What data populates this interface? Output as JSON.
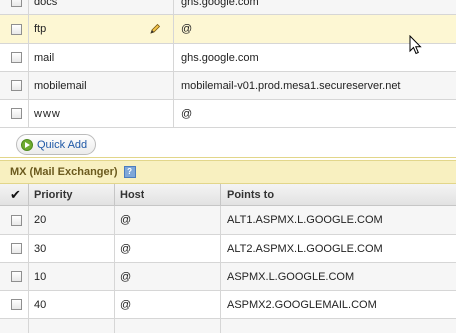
{
  "top_records": [
    {
      "name": "docs",
      "value": "ghs.google.com",
      "highlighted": false,
      "editable": false
    },
    {
      "name": "ftp",
      "value": "@",
      "highlighted": true,
      "editable": true
    },
    {
      "name": "mail",
      "value": "ghs.google.com",
      "highlighted": false,
      "editable": false
    },
    {
      "name": "mobilemail",
      "value": "mobilemail-v01.prod.mesa1.secureserver.net",
      "highlighted": false,
      "editable": false
    },
    {
      "name": "www",
      "value": "@",
      "highlighted": false,
      "editable": false
    }
  ],
  "quick_add": {
    "label": "Quick Add",
    "icon": "play-circle-icon"
  },
  "mx_section": {
    "title": "MX (Mail Exchanger)",
    "help_icon": "help-icon"
  },
  "mx_table": {
    "headers": {
      "check_all": "✔",
      "priority": "Priority",
      "host": "Host",
      "points_to": "Points to"
    },
    "rows": [
      {
        "priority": "20",
        "host": "@",
        "points_to": "ALT1.ASPMX.L.GOOGLE.COM"
      },
      {
        "priority": "30",
        "host": "@",
        "points_to": "ALT2.ASPMX.L.GOOGLE.COM"
      },
      {
        "priority": "10",
        "host": "@",
        "points_to": "ASPMX.L.GOOGLE.COM"
      },
      {
        "priority": "40",
        "host": "@",
        "points_to": "ASPMX2.GOOGLEMAIL.COM"
      }
    ]
  },
  "colors": {
    "highlight_row": "#fdf7d3",
    "section_bg": "#f8f0c0",
    "link": "#1f58a6"
  }
}
